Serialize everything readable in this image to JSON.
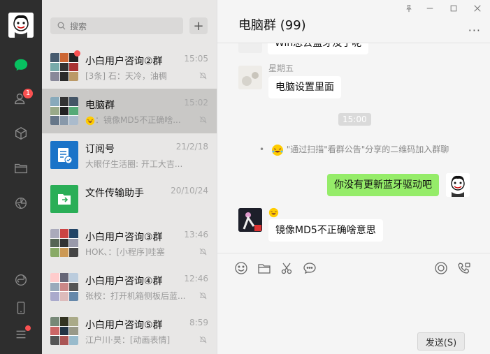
{
  "nav": {
    "contacts_badge": "1"
  },
  "search": {
    "placeholder": "搜索",
    "add_label": "+"
  },
  "conversations": [
    {
      "name": "小白用户咨询②群",
      "time": "15:05",
      "preview": "[3条] 石：天冷，油稠",
      "muted": true,
      "unread_dot": true
    },
    {
      "name": "电脑群",
      "time": "15:02",
      "preview": "：镜像MD5不正确啥...",
      "muted": true,
      "active": true
    },
    {
      "name": "订阅号",
      "time": "21/2/18",
      "preview": "大眼仔生活圈: 开工大吉..."
    },
    {
      "name": "文件传输助手",
      "time": "20/10/24",
      "preview": ""
    },
    {
      "name": "小白用户咨询③群",
      "time": "13:46",
      "preview": "HOK、：[小程序]哇塞",
      "muted": true
    },
    {
      "name": "小白用户咨询④群",
      "time": "12:46",
      "preview": "张校：打开机箱侧板后蓝...",
      "muted": true
    },
    {
      "name": "小白用户咨询⑤群",
      "time": "8:59",
      "preview": "江户川·昊：[动画表情]",
      "muted": true
    }
  ],
  "chat": {
    "title": "电脑群 (99)",
    "partial_bubble": "Win总去蓝牙没了呢",
    "msg1_sender": "星期五",
    "msg1_text": "电脑设置里面",
    "time_divider": "15:00",
    "system_msg": "\"通过扫描\"看群公告\"分享的二维码加入群聊",
    "my_msg": "你没有更新蓝牙驱动吧",
    "msg3_text": "镜像MD5不正确啥意思",
    "send_label": "发送(S)"
  },
  "colors": {
    "nav_bg": "#2e2e2e",
    "accent_green": "#07c160",
    "my_bubble": "#95ec69",
    "badge_red": "#fa5151"
  }
}
